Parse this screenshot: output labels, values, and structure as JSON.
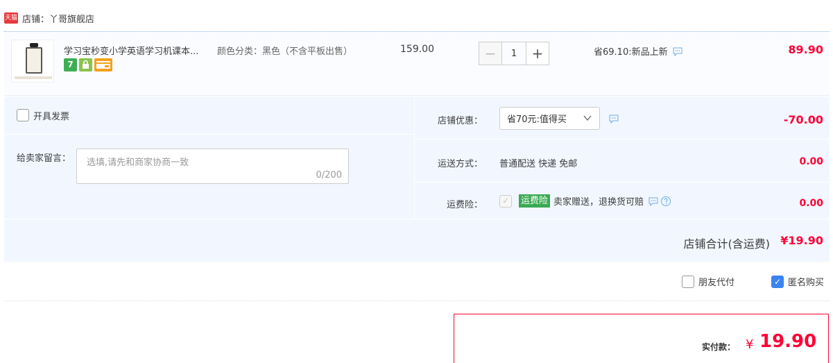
{
  "shop": {
    "badge": "天猫",
    "label": "店铺：丫哥旗舰店"
  },
  "item": {
    "title": "学习宝秒变小学英语学习机课本...",
    "sku": "颜色分类：黑色（不含平板出售）",
    "unit_price": "159.00",
    "quantity": "1",
    "minus": "−",
    "plus": "+",
    "promo": "省69.10:新品上新",
    "total": "89.90",
    "service_icons": [
      "seven-day-return-icon",
      "lock-icon",
      "card-icon"
    ],
    "service_seven": "7"
  },
  "invoice": {
    "label": "开具发票",
    "checked": false
  },
  "message": {
    "label": "给卖家留言：",
    "placeholder": "选填,请先和商家协商一致",
    "count": "0/200"
  },
  "coupon": {
    "label": "店铺优惠：",
    "value": "省70元:值得买",
    "amount": "-70.00"
  },
  "shipping": {
    "label": "运送方式：",
    "value": "普通配送 快递 免邮",
    "amount": "0.00"
  },
  "insurance": {
    "label": "运费险：",
    "tag": "运费险",
    "text": "卖家赠送，退换货可赔",
    "amount": "0.00"
  },
  "subtotal": {
    "label": "店铺合计(含运费)",
    "value": "¥19.90"
  },
  "options": {
    "friend_pay": "朋友代付",
    "anonymous": "匿名购买"
  },
  "payment": {
    "label": "实付款：",
    "currency": "¥",
    "value": "19.90"
  },
  "colors": {
    "accent_red": "#ff0036",
    "checkbox_blue": "#3a83f0",
    "panel_bg": "#f2f7ff",
    "insurance_green": "#3aa953"
  }
}
